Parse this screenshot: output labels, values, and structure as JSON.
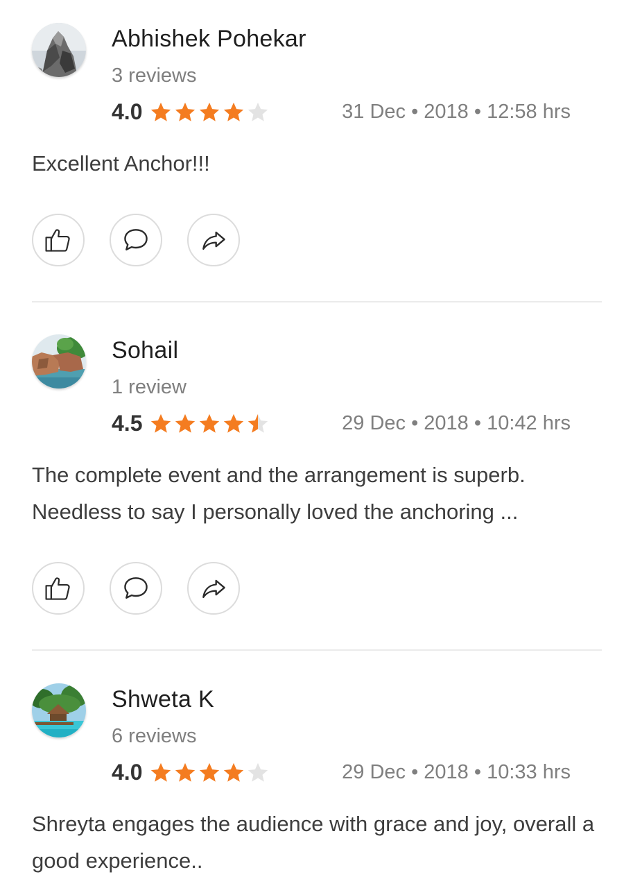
{
  "reviews": [
    {
      "name": "Abhishek Pohekar",
      "count": "3 reviews",
      "score": "4.0",
      "stars": [
        1,
        1,
        1,
        1,
        0
      ],
      "date": "31 Dec • 2018 • 12:58 hrs",
      "text": "Excellent Anchor!!!",
      "avatar": "rock-avatar"
    },
    {
      "name": "Sohail",
      "count": "1 review",
      "score": "4.5",
      "stars": [
        1,
        1,
        1,
        1,
        0.5
      ],
      "date": "29 Dec • 2018 • 10:42 hrs",
      "text": "The complete event and the arrangement is superb. Needless to say I personally loved the anchoring ...",
      "avatar": "coast-avatar"
    },
    {
      "name": "Shweta K",
      "count": "6 reviews",
      "score": "4.0",
      "stars": [
        1,
        1,
        1,
        1,
        0
      ],
      "date": "29 Dec • 2018 • 10:33 hrs",
      "text": "Shreyta engages the audience with grace and joy, overall a good experience..",
      "avatar": "resort-avatar"
    }
  ],
  "icons": {
    "like": "thumbs-up-icon",
    "comment": "comment-icon",
    "share": "share-icon",
    "star": "star-icon"
  },
  "colors": {
    "star_filled": "#f47c20",
    "star_empty": "#e3e3e3",
    "muted_text": "#7f7f7f"
  }
}
